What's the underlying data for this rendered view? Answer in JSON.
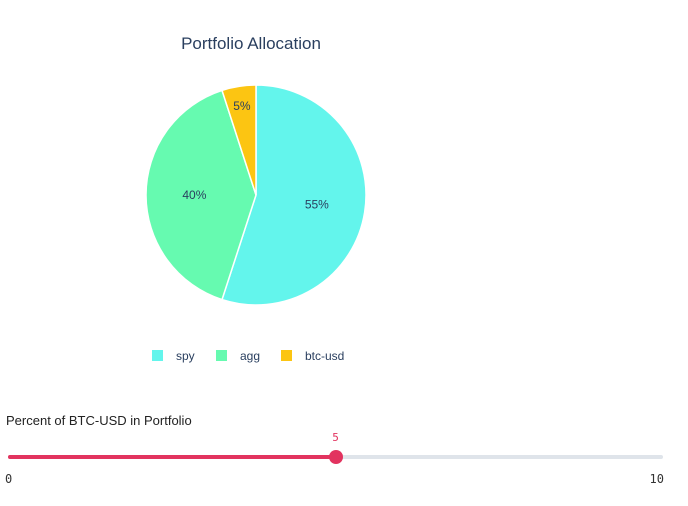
{
  "chart_data": {
    "type": "pie",
    "title": "Portfolio Allocation",
    "categories": [
      "spy",
      "agg",
      "btc-usd"
    ],
    "values": [
      55,
      40,
      5
    ],
    "labels": [
      "55%",
      "40%",
      "5%"
    ],
    "colors": [
      "#63f5ec",
      "#66fab0",
      "#fcc512"
    ],
    "legend_position": "bottom",
    "direction": "clockwise",
    "start": "top"
  },
  "slider": {
    "label": "Percent of BTC-USD in Portfolio",
    "min": 0,
    "max": 10,
    "value": 5,
    "min_label": "0",
    "max_label": "10",
    "value_label": "5",
    "color": "#e2335f",
    "track_color": "#dfe4ea"
  }
}
